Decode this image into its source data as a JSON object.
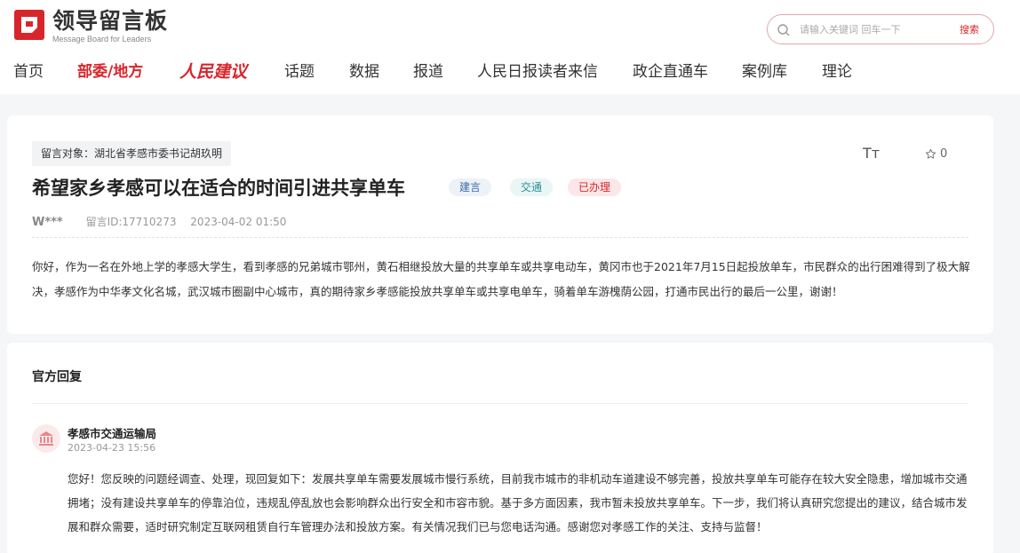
{
  "brand": {
    "name_cn": "领导留言板",
    "name_en": "Message Board for Leaders",
    "color": "#d7262b"
  },
  "search": {
    "placeholder": "请输入关键词 回车一下",
    "button_label": "搜索"
  },
  "nav": {
    "items": [
      {
        "label": "首页"
      },
      {
        "label": "部委/地方"
      },
      {
        "label": "人民建议"
      },
      {
        "label": "话题"
      },
      {
        "label": "数据"
      },
      {
        "label": "报道"
      },
      {
        "label": "人民日报读者来信"
      },
      {
        "label": "政企直通车"
      },
      {
        "label": "案例库"
      },
      {
        "label": "理论"
      }
    ],
    "active_index": 1
  },
  "message": {
    "target": "留言对象：湖北省孝感市委书记胡玖明",
    "favorite_count": "0",
    "font_tool": "Tт",
    "title": "希望家乡孝感可以在适合的时间引进共享单车",
    "tags": [
      "建言",
      "交通",
      "已办理"
    ],
    "author": "W***",
    "message_id": "留言ID:17710273",
    "date": "2023-04-02 01:50",
    "body": "你好，作为一名在外地上学的孝感大学生，看到孝感的兄弟城市鄂州，黄石相继投放大量的共享单车或共享电动车，黄冈市也于2021年7月15日起投放单车，市民群众的出行困难得到了极大解决，孝感作为中华孝文化名城，武汉城市圈副中心城市，真的期待家乡孝感能投放共享单车或共享电单车，骑着单车游槐荫公园，打通市民出行的最后一公里，谢谢！"
  },
  "reply": {
    "section_title": "官方回复",
    "department": "孝感市交通运输局",
    "date": "2023-04-23 15:56",
    "body": "您好！您反映的问题经调查、处理，现回复如下：发展共享单车需要发展城市慢行系统，目前我市城市的非机动车道建设不够完善，投放共享单车可能存在较大安全隐患，增加城市交通拥堵；没有建设共享单车的停靠泊位，违规乱停乱放也会影响群众出行安全和市容市貌。基于多方面因素，我市暂未投放共享单车。下一步，我们将认真研究您提出的建议，结合城市发展和群众需要，适时研究制定互联网租赁自行车管理办法和投放方案。有关情况我们已与您电话沟通。感谢您对孝感工作的关注、支持与监督！"
  }
}
